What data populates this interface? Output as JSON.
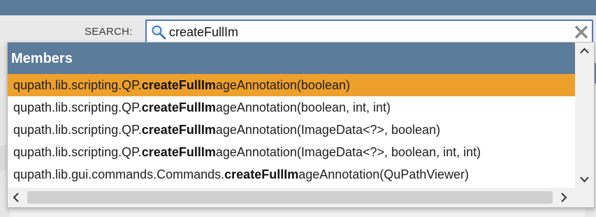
{
  "search": {
    "label": "SEARCH:",
    "value": "createFullIm",
    "icons": {
      "search": "magnifier-icon",
      "clear": "clear-x-icon"
    }
  },
  "dropdown": {
    "header": "Members",
    "results": [
      {
        "prefix": "qupath.lib.scripting.QP.",
        "match": "createFullIm",
        "suffix": "ageAnnotation(boolean)",
        "selected": true
      },
      {
        "prefix": "qupath.lib.scripting.QP.",
        "match": "createFullIm",
        "suffix": "ageAnnotation(boolean, int, int)",
        "selected": false
      },
      {
        "prefix": "qupath.lib.scripting.QP.",
        "match": "createFullIm",
        "suffix": "ageAnnotation(ImageData<?>, boolean)",
        "selected": false
      },
      {
        "prefix": "qupath.lib.scripting.QP.",
        "match": "createFullIm",
        "suffix": "ageAnnotation(ImageData<?>, boolean, int, int)",
        "selected": false
      },
      {
        "prefix": "qupath.lib.gui.commands.Commands.",
        "match": "createFullIm",
        "suffix": "ageAnnotation(QuPathViewer)",
        "selected": false
      }
    ],
    "scroll_icons": {
      "up": "chevron-up-icon",
      "down": "chevron-down-icon",
      "left": "chevron-left-icon",
      "right": "chevron-right-icon"
    }
  },
  "colors": {
    "header_bar": "#5b7b9a",
    "selection": "#eda02b",
    "search_border": "#4a78c2"
  }
}
